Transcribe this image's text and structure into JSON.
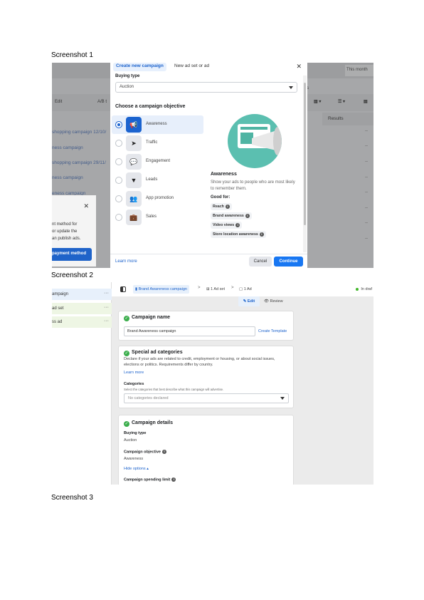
{
  "captions": [
    "Screenshot 1",
    "Screenshot 2",
    "Screenshot 3"
  ],
  "shot1": {
    "background": {
      "month_label": "This month",
      "toolbar_edit": "Edit",
      "toolbar_ab": "A/B t",
      "column_results": "Results",
      "s_tag": "s",
      "campaign_links": [
        "shopping campaign 12/10/",
        "ness campaign",
        "shopping campaign 29/11/",
        "ness campaign",
        "eness campaign"
      ],
      "dash": "–",
      "popup": {
        "close": "✕",
        "text_lines": [
          "nt method for",
          "or update the",
          "an publish ads."
        ],
        "button": "payment method"
      }
    },
    "modal": {
      "tabs": [
        "Create new campaign",
        "New ad set or ad"
      ],
      "close": "✕",
      "buying_type_label": "Buying type",
      "buying_type_value": "Auction",
      "objective_heading": "Choose a campaign objective",
      "objectives": [
        {
          "label": "Awareness",
          "icon": "megaphone-icon",
          "glyph": "📢",
          "selected": true
        },
        {
          "label": "Traffic",
          "icon": "cursor-icon",
          "glyph": "➤",
          "selected": false
        },
        {
          "label": "Engagement",
          "icon": "chat-icon",
          "glyph": "💬",
          "selected": false
        },
        {
          "label": "Leads",
          "icon": "funnel-icon",
          "glyph": "▼",
          "selected": false
        },
        {
          "label": "App promotion",
          "icon": "people-icon",
          "glyph": "👥",
          "selected": false
        },
        {
          "label": "Sales",
          "icon": "briefcase-icon",
          "glyph": "💼",
          "selected": false
        }
      ],
      "detail_title": "Awareness",
      "detail_desc": "Show your ads to people who are most likely to remember them.",
      "good_for_label": "Good for:",
      "good_for": [
        "Reach",
        "Brand awareness",
        "Video views",
        "Store location awareness"
      ],
      "info_glyph": "i",
      "learn_more": "Learn more",
      "cancel": "Cancel",
      "continue": "Continue"
    }
  },
  "shot2": {
    "nav": [
      {
        "label": "ampaign",
        "more": "···"
      },
      {
        "label": "ad set",
        "more": "···"
      },
      {
        "label": "ss ad",
        "more": "···"
      }
    ],
    "breadcrumbs": [
      "Brand Awareness campaign",
      "1 Ad set",
      "1 Ad"
    ],
    "crumb_sep": ">",
    "status": "In draf",
    "edit": "Edit",
    "review": "Review",
    "campaign_name": {
      "title": "Campaign name",
      "value": "Brand Awareness campaign",
      "create_template": "Create Template"
    },
    "special_ad": {
      "title": "Special ad categories",
      "desc_lines": [
        "Declare if your ads are related to credit, employment or housing, or about social issues,",
        "elections or politics. Requirements differ by country."
      ],
      "learn_more": "Learn more",
      "categories_label": "Categories",
      "categories_hint": "Select the categories that best describe what this campaign will advertise.",
      "categories_placeholder": "No categories declared"
    },
    "details": {
      "title": "Campaign details",
      "buying_type_label": "Buying type",
      "buying_type_value": "Auction",
      "objective_label": "Campaign objective",
      "objective_value": "Awareness",
      "hide_options": "Hide options ▴",
      "spending_limit_label": "Campaign spending limit"
    },
    "check_glyph": "✓",
    "info_glyph": "i"
  },
  "colors": {
    "accent": "#1877f2",
    "link": "#1d63cc",
    "success": "#3cae4d"
  }
}
